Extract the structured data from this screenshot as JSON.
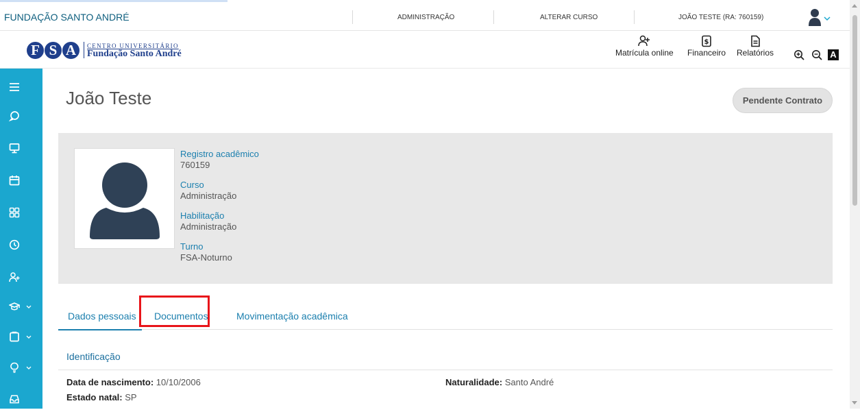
{
  "topbar": {
    "institution": "FUNDAÇÃO SANTO ANDRÉ",
    "links": [
      "ADMINISTRAÇÃO",
      "ALTERAR CURSO",
      "JOÃO TESTE (RA: 760159)"
    ]
  },
  "logo": {
    "letters": [
      "F",
      "S",
      "A"
    ],
    "line1": "CENTRO UNIVERSITÁRIO",
    "line2": "Fundação Santo André"
  },
  "header_nav": [
    {
      "label": "Matrícula online",
      "icon": "add-user-icon"
    },
    {
      "label": "Financeiro",
      "icon": "dollar-document-icon"
    },
    {
      "label": "Relatórios",
      "icon": "document-icon"
    }
  ],
  "zoom_controls": {
    "zoom_in": "zoom-in-icon",
    "zoom_out": "zoom-out-icon",
    "contrast": "A"
  },
  "sidebar": {
    "items": [
      "menu-icon",
      "chat-icon",
      "monitor-icon",
      "calendar-icon",
      "grid-icon",
      "clock-icon",
      "add-user-icon",
      "graduation-cap-icon",
      "clipboard-icon",
      "lightbulb-icon",
      "inbox-icon"
    ]
  },
  "profile": {
    "name": "João Teste",
    "status_button": "Pendente Contrato",
    "fields": [
      {
        "label": "Registro acadêmico",
        "value": "760159"
      },
      {
        "label": "Curso",
        "value": "Administração"
      },
      {
        "label": "Habilitação",
        "value": "Administração"
      },
      {
        "label": "Turno",
        "value": "FSA-Noturno"
      }
    ]
  },
  "tabs": [
    "Dados pessoais",
    "Documentos",
    "Movimentação acadêmica"
  ],
  "active_tab": "Dados pessoais",
  "section": {
    "title": "Identificação",
    "rows": [
      {
        "label": "Data de nascimento:",
        "value": "10/10/2006"
      },
      {
        "label": "Naturalidade:",
        "value": "Santo André"
      },
      {
        "label": "Estado natal:",
        "value": "SP"
      }
    ]
  },
  "colors": {
    "sidebar": "#1ba7cf",
    "accent": "#1b7fae",
    "highlight": "#e8141a",
    "brand": "#1f3f8c"
  }
}
